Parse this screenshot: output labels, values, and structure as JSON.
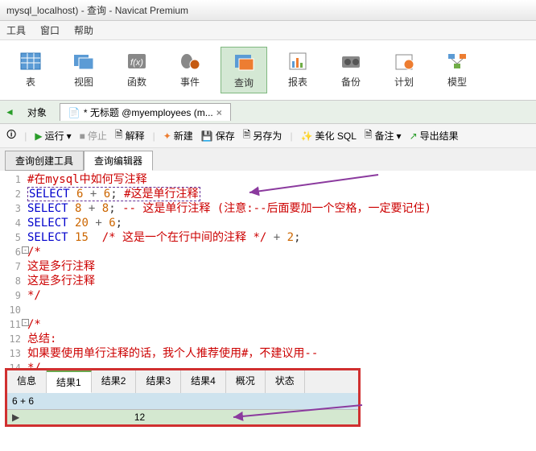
{
  "title": "mysql_localhost) - 查询 - Navicat Premium",
  "menu": {
    "tools": "工具",
    "window": "窗口",
    "help": "帮助"
  },
  "ribbon": {
    "table": "表",
    "view": "视图",
    "func": "函数",
    "event": "事件",
    "query": "查询",
    "report": "报表",
    "backup": "备份",
    "plan": "计划",
    "model": "模型"
  },
  "objects_tab": "对象",
  "doc_tab": "* 无标题 @myemployees (m...",
  "tb": {
    "run": "运行",
    "stop": "停止",
    "explain": "解释",
    "new": "新建",
    "save": "保存",
    "saveas": "另存为",
    "beautify": "美化 SQL",
    "note": "备注",
    "export": "导出结果"
  },
  "subtabs": {
    "builder": "查询创建工具",
    "editor": "查询编辑器"
  },
  "code": {
    "l1": "#在mysql中如何写注释",
    "l2_sel": "SELECT",
    "l2_a": "6",
    "l2_op": "+",
    "l2_b": "6",
    "l2_cmt": "#这是单行注释",
    "l3_sel": "SELECT",
    "l3_a": "8",
    "l3_op": "+",
    "l3_b": "8",
    "l3_cmt": "-- 这是单行注释 (注意:--后面要加一个空格，一定要记住)",
    "l4_sel": "SELECT",
    "l4_a": "20",
    "l4_op": "+",
    "l4_b": "6",
    "l5_sel": "SELECT",
    "l5_a": "15",
    "l5_cmt": "/* 这是一个在行中间的注释 */",
    "l5_op": "+",
    "l5_b": "2",
    "l6": "/*",
    "l7": "这是多行注释",
    "l8": "这是多行注释",
    "l9": "*/",
    "l11": "/*",
    "l12": "总结:",
    "l13": "如果要使用单行注释的话，我个人推荐使用#，不建议用--",
    "l14": "*/"
  },
  "result": {
    "tabs": {
      "info": "信息",
      "r1": "结果1",
      "r2": "结果2",
      "r3": "结果3",
      "r4": "结果4",
      "summary": "概况",
      "status": "状态"
    },
    "header": "6 + 6",
    "nav": "▶",
    "value": "12"
  }
}
